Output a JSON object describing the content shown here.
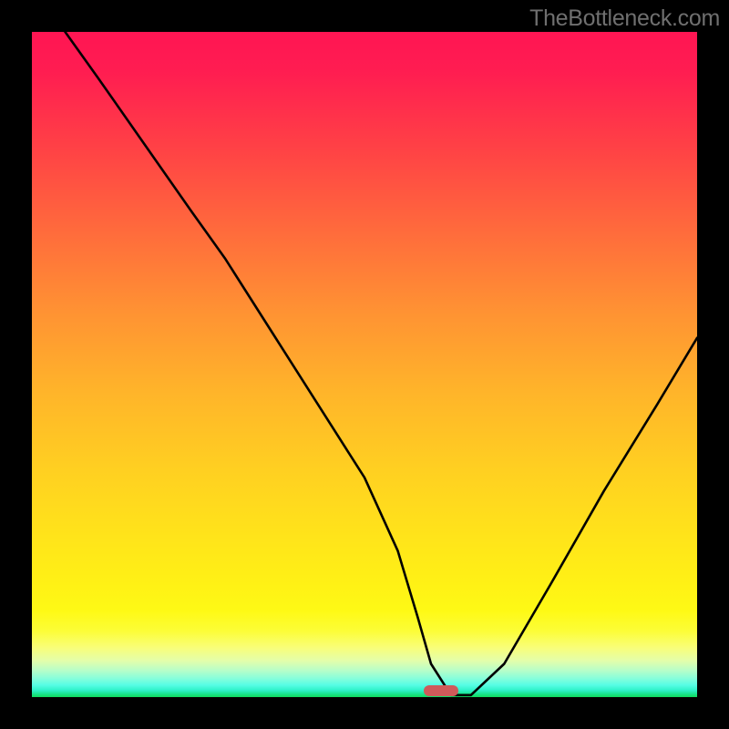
{
  "attribution": "TheBottleneck.com",
  "chart_data": {
    "type": "line",
    "title": "",
    "xlabel": "",
    "ylabel": "",
    "xlim": [
      0,
      100
    ],
    "ylim": [
      0,
      100
    ],
    "x": [
      5,
      10,
      17,
      24,
      29,
      36,
      43,
      50,
      55,
      58,
      60,
      63,
      66,
      71,
      78,
      86,
      94,
      100
    ],
    "values": [
      100,
      93,
      83,
      73,
      66,
      55,
      44,
      33,
      22,
      12,
      5,
      0.3,
      0.3,
      5,
      17,
      31,
      44,
      54
    ],
    "marker_x": 61.5,
    "gradient_stops": [
      {
        "stop": 0,
        "color": "#ff1553"
      },
      {
        "stop": 50,
        "color": "#ffa030"
      },
      {
        "stop": 85,
        "color": "#fff317"
      },
      {
        "stop": 100,
        "color": "#0fdb5d"
      }
    ]
  }
}
